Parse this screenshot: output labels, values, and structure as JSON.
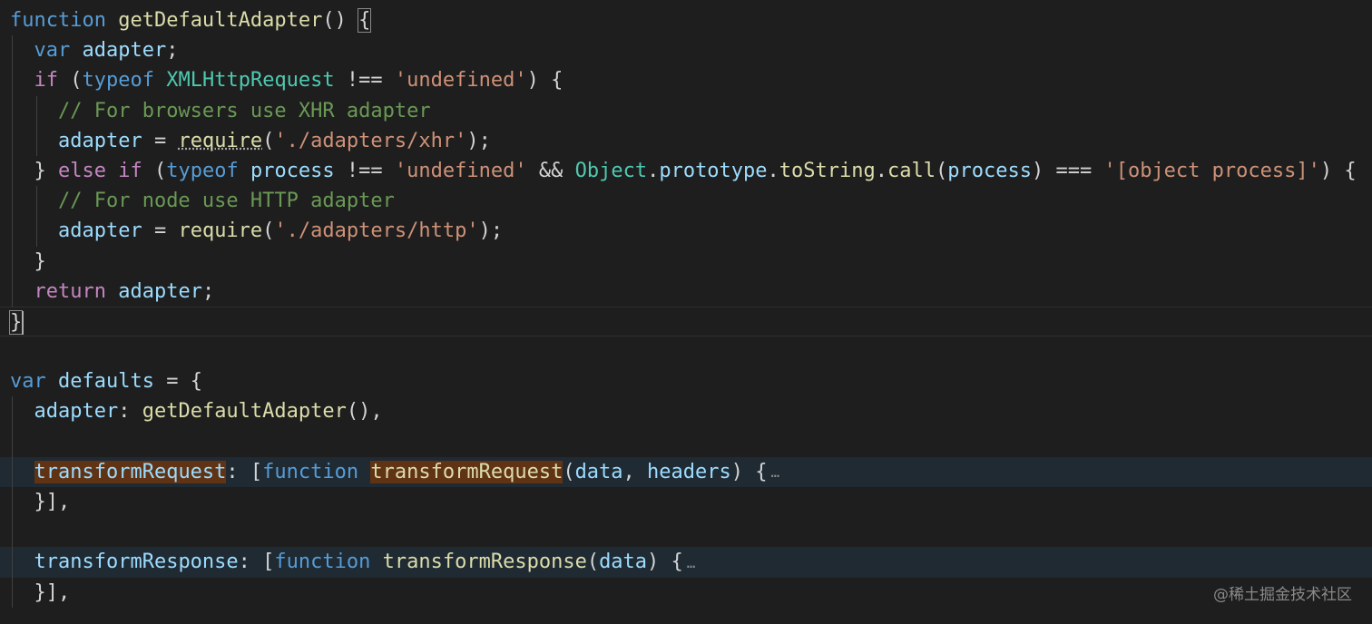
{
  "code": {
    "lines": [
      [
        {
          "t": "function",
          "c": "kw"
        },
        {
          "t": " ",
          "c": "pl"
        },
        {
          "t": "getDefaultAdapter",
          "c": "fn"
        },
        {
          "t": "() ",
          "c": "pl"
        },
        {
          "t": "{",
          "c": "box"
        }
      ],
      [
        {
          "t": "  ",
          "c": "pl"
        },
        {
          "t": "var",
          "c": "kw"
        },
        {
          "t": " ",
          "c": "pl"
        },
        {
          "t": "adapter",
          "c": "var"
        },
        {
          "t": ";",
          "c": "pl"
        }
      ],
      [
        {
          "t": "  ",
          "c": "pl"
        },
        {
          "t": "if",
          "c": "ctl"
        },
        {
          "t": " (",
          "c": "pl"
        },
        {
          "t": "typeof",
          "c": "kw"
        },
        {
          "t": " ",
          "c": "pl"
        },
        {
          "t": "XMLHttpRequest",
          "c": "cls"
        },
        {
          "t": " !== ",
          "c": "pl"
        },
        {
          "t": "'undefined'",
          "c": "str"
        },
        {
          "t": ") {",
          "c": "pl"
        }
      ],
      [
        {
          "t": "    ",
          "c": "pl"
        },
        {
          "t": "// For browsers use XHR adapter",
          "c": "cmt"
        }
      ],
      [
        {
          "t": "    ",
          "c": "pl"
        },
        {
          "t": "adapter",
          "c": "var"
        },
        {
          "t": " = ",
          "c": "pl"
        },
        {
          "t": "require",
          "c": "fnsq"
        },
        {
          "t": "(",
          "c": "pl"
        },
        {
          "t": "'./adapters/xhr'",
          "c": "str"
        },
        {
          "t": ");",
          "c": "pl"
        }
      ],
      [
        {
          "t": "  } ",
          "c": "pl"
        },
        {
          "t": "else",
          "c": "ctl"
        },
        {
          "t": " ",
          "c": "pl"
        },
        {
          "t": "if",
          "c": "ctl"
        },
        {
          "t": " (",
          "c": "pl"
        },
        {
          "t": "typeof",
          "c": "kw"
        },
        {
          "t": " ",
          "c": "pl"
        },
        {
          "t": "process",
          "c": "var"
        },
        {
          "t": " !== ",
          "c": "pl"
        },
        {
          "t": "'undefined'",
          "c": "str"
        },
        {
          "t": " && ",
          "c": "pl"
        },
        {
          "t": "Object",
          "c": "cls"
        },
        {
          "t": ".",
          "c": "pl"
        },
        {
          "t": "prototype",
          "c": "var"
        },
        {
          "t": ".",
          "c": "pl"
        },
        {
          "t": "toString",
          "c": "fn"
        },
        {
          "t": ".",
          "c": "pl"
        },
        {
          "t": "call",
          "c": "fn"
        },
        {
          "t": "(",
          "c": "pl"
        },
        {
          "t": "process",
          "c": "var"
        },
        {
          "t": ") === ",
          "c": "pl"
        },
        {
          "t": "'[object process]'",
          "c": "str"
        },
        {
          "t": ") {",
          "c": "pl"
        }
      ],
      [
        {
          "t": "    ",
          "c": "pl"
        },
        {
          "t": "// For node use HTTP adapter",
          "c": "cmt"
        }
      ],
      [
        {
          "t": "    ",
          "c": "pl"
        },
        {
          "t": "adapter",
          "c": "var"
        },
        {
          "t": " = ",
          "c": "pl"
        },
        {
          "t": "require",
          "c": "fn"
        },
        {
          "t": "(",
          "c": "pl"
        },
        {
          "t": "'./adapters/http'",
          "c": "str"
        },
        {
          "t": ");",
          "c": "pl"
        }
      ],
      [
        {
          "t": "  }",
          "c": "pl"
        }
      ],
      [
        {
          "t": "  ",
          "c": "pl"
        },
        {
          "t": "return",
          "c": "ctl"
        },
        {
          "t": " ",
          "c": "pl"
        },
        {
          "t": "adapter",
          "c": "var"
        },
        {
          "t": ";",
          "c": "pl"
        }
      ],
      [
        {
          "t": "}",
          "c": "box"
        }
      ],
      [],
      [
        {
          "t": "var",
          "c": "kw"
        },
        {
          "t": " ",
          "c": "pl"
        },
        {
          "t": "defaults",
          "c": "var"
        },
        {
          "t": " = {",
          "c": "pl"
        }
      ],
      [
        {
          "t": "  ",
          "c": "pl"
        },
        {
          "t": "adapter",
          "c": "var"
        },
        {
          "t": ": ",
          "c": "pl"
        },
        {
          "t": "getDefaultAdapter",
          "c": "fn"
        },
        {
          "t": "(),",
          "c": "pl"
        }
      ],
      [],
      [
        {
          "t": "  ",
          "c": "pl"
        },
        {
          "t": "transformRequest",
          "c": "varhl"
        },
        {
          "t": ": [",
          "c": "pl"
        },
        {
          "t": "function",
          "c": "kw"
        },
        {
          "t": " ",
          "c": "pl"
        },
        {
          "t": "transformRequest",
          "c": "fnhl"
        },
        {
          "t": "(",
          "c": "pl"
        },
        {
          "t": "data",
          "c": "var"
        },
        {
          "t": ", ",
          "c": "pl"
        },
        {
          "t": "headers",
          "c": "var"
        },
        {
          "t": ") {",
          "c": "pl"
        },
        {
          "t": "…",
          "c": "ell"
        }
      ],
      [
        {
          "t": "  }],",
          "c": "pl"
        }
      ],
      [],
      [
        {
          "t": "  ",
          "c": "pl"
        },
        {
          "t": "transformResponse",
          "c": "var"
        },
        {
          "t": ": [",
          "c": "pl"
        },
        {
          "t": "function",
          "c": "kw"
        },
        {
          "t": " ",
          "c": "pl"
        },
        {
          "t": "transformResponse",
          "c": "fn"
        },
        {
          "t": "(",
          "c": "pl"
        },
        {
          "t": "data",
          "c": "var"
        },
        {
          "t": ") {",
          "c": "pl"
        },
        {
          "t": "…",
          "c": "ell"
        }
      ],
      [
        {
          "t": "  }],",
          "c": "pl"
        }
      ]
    ],
    "current_line": 10,
    "highlight_lines": [
      15,
      18
    ]
  },
  "watermark": "@稀土掘金技术社区",
  "colors": {
    "background": "#1e1e1e",
    "keyword": "#569cd6",
    "control": "#c586c0",
    "function": "#dcdcaa",
    "variable": "#9cdcfe",
    "class": "#4ec9b0",
    "string": "#ce9178",
    "comment": "#6a9955",
    "word_highlight": "#613315"
  }
}
